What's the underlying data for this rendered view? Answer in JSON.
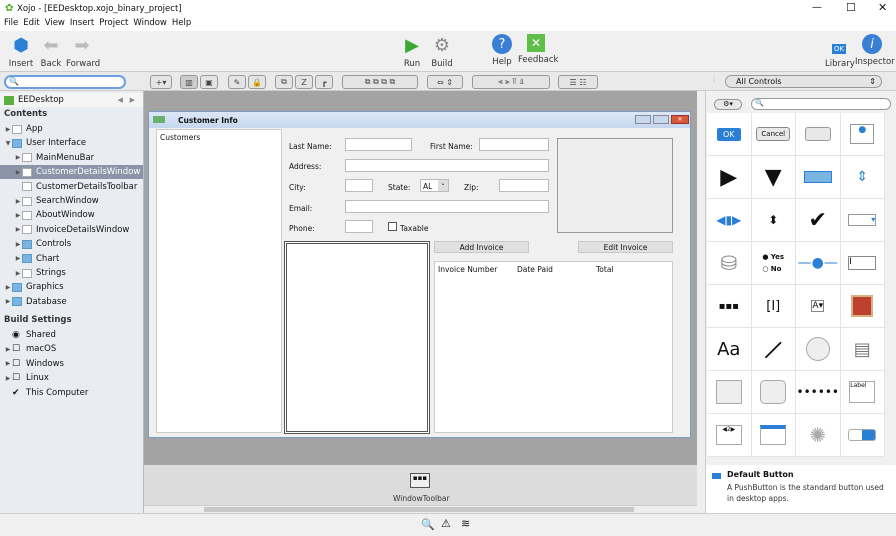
{
  "window": {
    "title": "Xojo - [EEDesktop.xojo_binary_project]"
  },
  "menu": [
    "File",
    "Edit",
    "View",
    "Insert",
    "Project",
    "Window",
    "Help"
  ],
  "toolbar": {
    "insert": "Insert",
    "back": "Back",
    "forward": "Forward",
    "run": "Run",
    "build": "Build",
    "help": "Help",
    "feedback": "Feedback",
    "library": "Library",
    "inspector": "Inspector"
  },
  "navigator": {
    "project": "EEDesktop",
    "search_placeholder": "",
    "contents": "Contents",
    "items": [
      "App",
      "User Interface",
      "MainMenuBar",
      "CustomerDetailsWindow",
      "CustomerDetailsToolbar",
      "SearchWindow",
      "AboutWindow",
      "InvoiceDetailsWindow",
      "Controls",
      "Chart",
      "Strings",
      "Graphics",
      "Database"
    ],
    "build_settings": "Build Settings",
    "build_items": [
      "Shared",
      "macOS",
      "Windows",
      "Linux",
      "This Computer"
    ]
  },
  "design": {
    "window_title": "Customer Info",
    "customers": "Customers",
    "last_name": "Last Name:",
    "first_name": "First Name:",
    "address": "Address:",
    "city": "City:",
    "state": "State:",
    "state_value": "AL",
    "zip": "Zip:",
    "email": "Email:",
    "phone": "Phone:",
    "taxable": "Taxable",
    "add_invoice": "Add Invoice",
    "edit_invoice": "Edit Invoice",
    "columns": [
      "Invoice Number",
      "Date Paid",
      "Total"
    ],
    "toolbar_item": "WindowToolbar"
  },
  "library": {
    "filter": "All Controls",
    "search_placeholder": "",
    "ok": "OK",
    "cancel": "Cancel",
    "yes": "Yes",
    "no": "No",
    "aa": "Aa",
    "label": "Label",
    "selected_title": "Default Button",
    "selected_desc": "A PushButton is the standard button used in desktop apps."
  },
  "colors": {
    "selection": "#8a96a8",
    "accent": "#2a7fd6",
    "run": "#3aa832"
  }
}
